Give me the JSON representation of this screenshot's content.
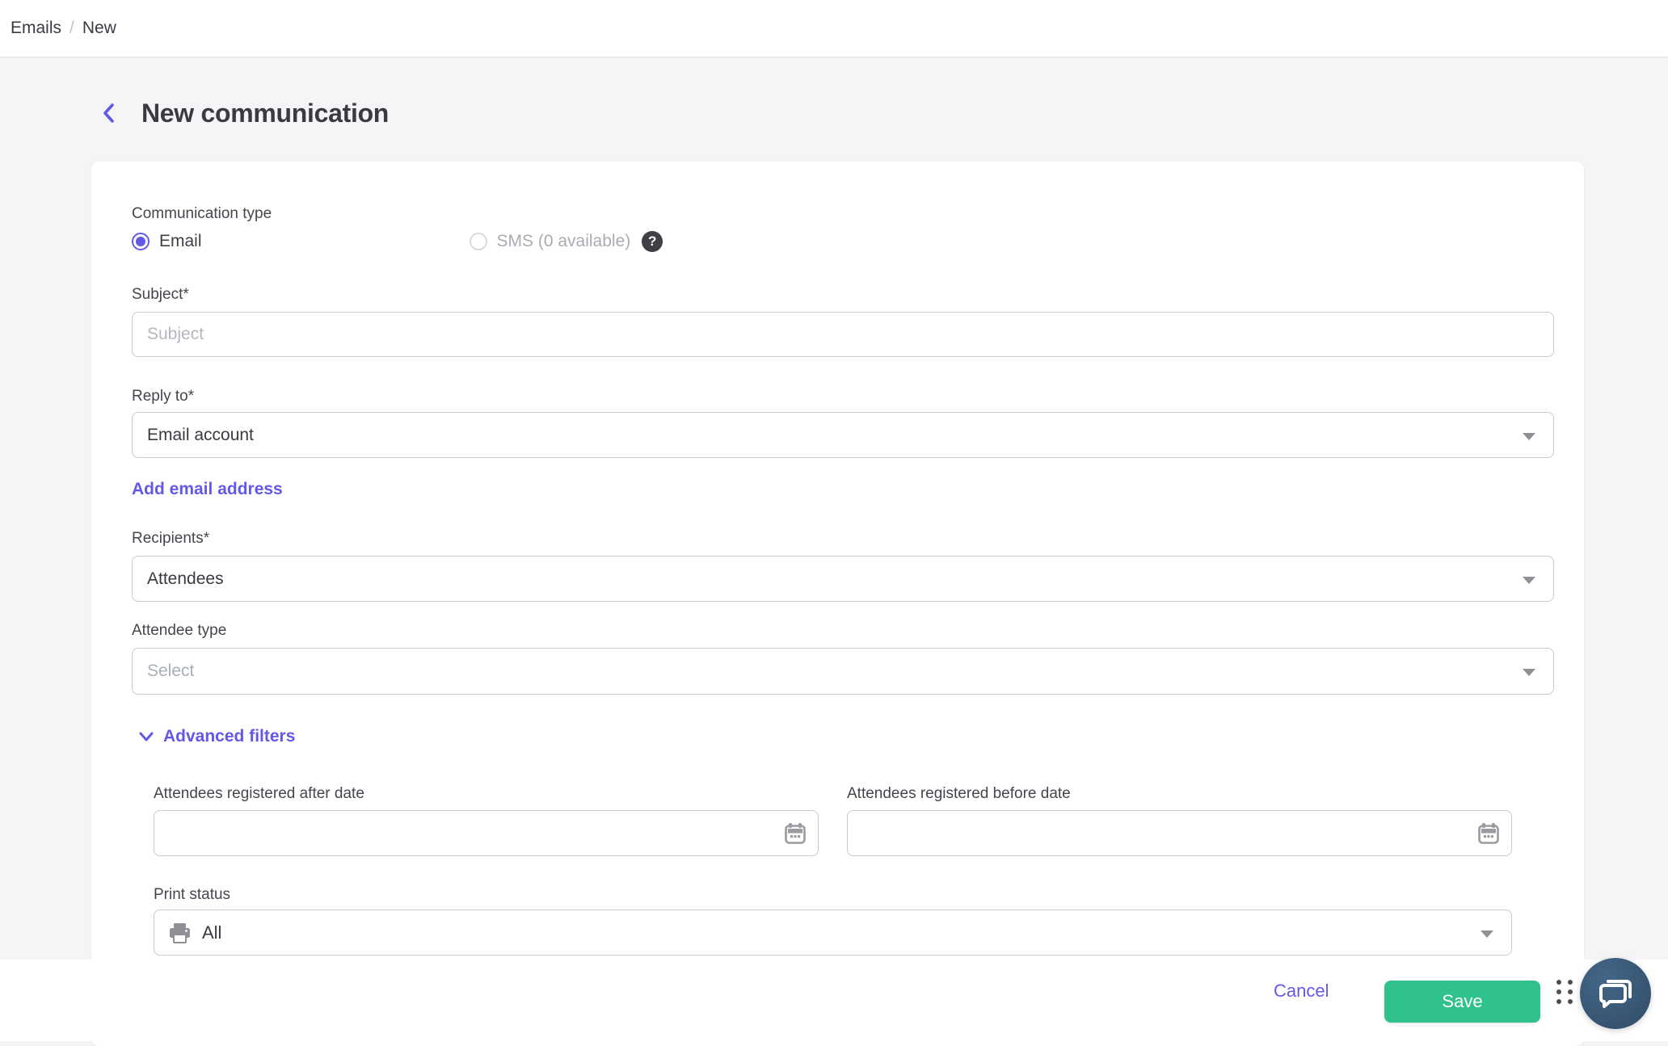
{
  "breadcrumb": {
    "items": [
      "Emails",
      "New"
    ],
    "separator": "/"
  },
  "header": {
    "title": "New communication"
  },
  "form": {
    "communication_type": {
      "label": "Communication type",
      "options": [
        {
          "label": "Email",
          "selected": true
        },
        {
          "label": "SMS (0 available)",
          "selected": false,
          "disabled": true
        }
      ]
    },
    "subject": {
      "label": "Subject*",
      "placeholder": "Subject",
      "value": ""
    },
    "reply_to": {
      "label": "Reply to*",
      "value": "Email account"
    },
    "add_email_link": "Add email address",
    "recipients": {
      "label": "Recipients*",
      "value": "Attendees"
    },
    "attendee_type": {
      "label": "Attendee type",
      "placeholder": "Select"
    },
    "advanced_filters": {
      "label": "Advanced filters",
      "expanded": true
    },
    "registered_after": {
      "label": "Attendees registered after date",
      "value": ""
    },
    "registered_before": {
      "label": "Attendees registered before date",
      "value": ""
    },
    "print_status": {
      "label": "Print status",
      "value": "All"
    }
  },
  "footer": {
    "cancel_label": "Cancel",
    "save_label": "Save"
  },
  "icons": {
    "help_glyph": "?"
  },
  "colors": {
    "accent_purple": "#6358e8",
    "save_green": "#2fc28c",
    "chat_fab": "#3a5a77",
    "page_background": "#f5f5f7",
    "help_badge": "#3f3f46"
  }
}
